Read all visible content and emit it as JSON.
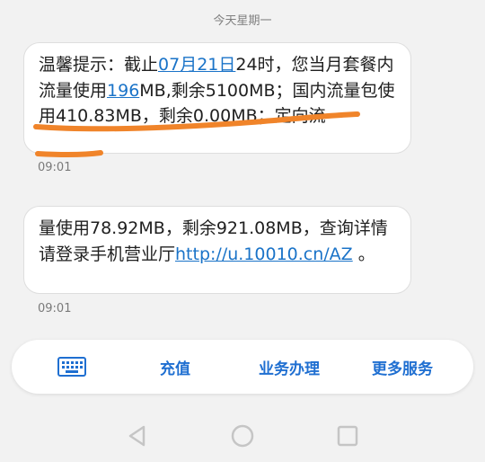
{
  "header": {
    "date_label": "今天星期一"
  },
  "messages": [
    {
      "segments": {
        "s0": "温馨提示：截止",
        "link_date": "07月21日",
        "s1": "24时，您当月套餐内流量使用",
        "link_usage": "196",
        "s2": "MB,剩余5100MB；国内流量包使用410.83MB，剩余0.00MB；定向流"
      },
      "time": "09:01"
    },
    {
      "segments": {
        "s0": "量使用78.92MB，剩余921.08MB，查询详情请登录手机营业厅",
        "link_url": "http://u.10010.cn/AZ",
        "s1": " 。"
      },
      "time": "09:01"
    }
  ],
  "actions": {
    "keyboard_icon": "keyboard-icon",
    "items": [
      {
        "label": "充值"
      },
      {
        "label": "业务办理"
      },
      {
        "label": "更多服务"
      }
    ]
  },
  "colors": {
    "accent": "#1f6fd1",
    "link": "#1a73c8",
    "annotation": "#f0842a",
    "background": "#f2f2f2"
  }
}
